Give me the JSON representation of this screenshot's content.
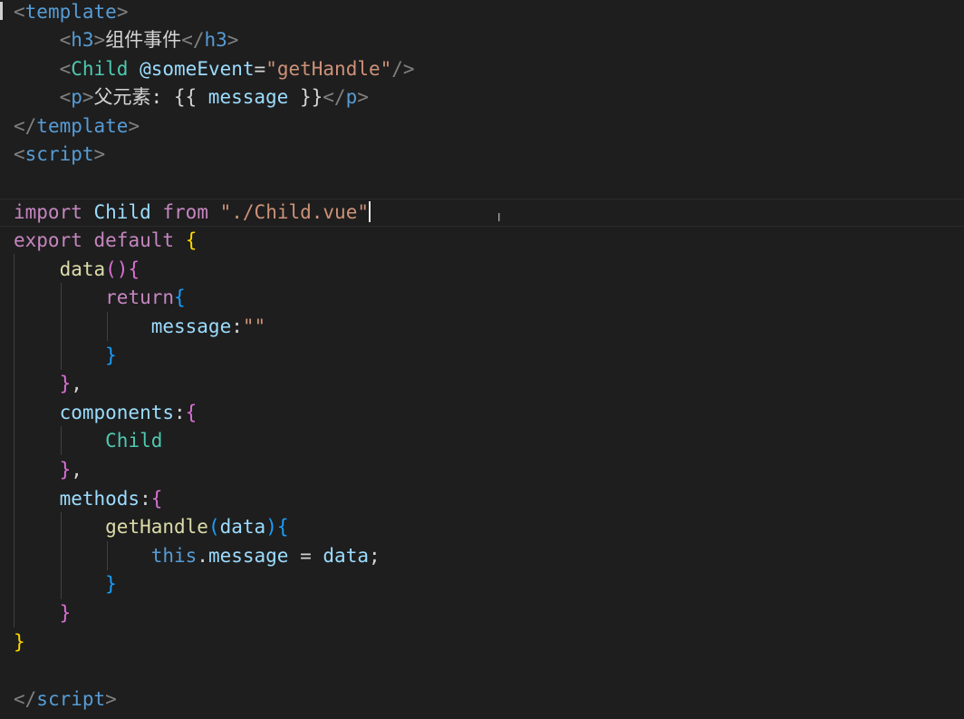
{
  "editor": {
    "language": "vue",
    "cursor_line": 8
  },
  "code": {
    "l1": {
      "lt": "<",
      "tag": "template",
      "gt": ">"
    },
    "l2": {
      "open": "<h3>",
      "text": "组件事件",
      "close": "</h3>"
    },
    "l3": {
      "lt": "<",
      "component": "Child",
      "attr": "@someEvent",
      "eq": "=",
      "value": "\"getHandle\"",
      "end": "/>"
    },
    "l4": {
      "open": "<p>",
      "text": "父元素: ",
      "mopen": "{{",
      "var": "message",
      "mclose": "}}",
      "close": "</p>"
    },
    "l5": {
      "lt": "</",
      "tag": "template",
      "gt": ">"
    },
    "l6": {
      "lt": "<",
      "tag": "script",
      "gt": ">"
    },
    "l8": {
      "kw1": "import",
      "name": "Child",
      "kw2": "from",
      "path": "\"./Child.vue\""
    },
    "l9": {
      "kw1": "export",
      "kw2": "default",
      "brace": "{"
    },
    "l10": {
      "fn": "data",
      "paren": "()",
      "brace": "{"
    },
    "l11": {
      "kw": "return",
      "brace": "{"
    },
    "l12": {
      "key": "message",
      "colon": ":",
      "value": "\"\""
    },
    "l13": {
      "brace": "}"
    },
    "l14": {
      "brace": "}",
      "comma": ","
    },
    "l15": {
      "key": "components",
      "colon": ":",
      "brace": "{"
    },
    "l16": {
      "name": "Child"
    },
    "l17": {
      "brace": "}",
      "comma": ","
    },
    "l18": {
      "key": "methods",
      "colon": ":",
      "brace": "{"
    },
    "l19": {
      "fn": "getHandle",
      "lp": "(",
      "param": "data",
      "rp": ")",
      "brace": "{"
    },
    "l20": {
      "this": "this",
      "dot": ".",
      "prop": "message",
      "eq": " = ",
      "val": "data",
      "semi": ";"
    },
    "l21": {
      "brace": "}"
    },
    "l22": {
      "brace": "}"
    },
    "l23": {
      "brace": "}"
    },
    "l25": {
      "lt": "</",
      "tag": "script",
      "gt": ">"
    }
  }
}
